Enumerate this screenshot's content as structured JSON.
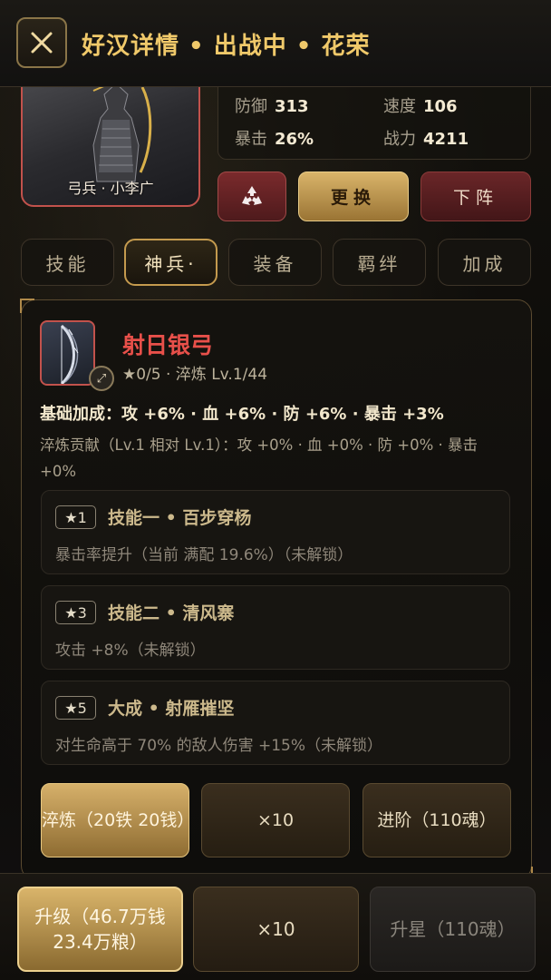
{
  "header": {
    "title": "好汉详情 • 出战中 • 花荣"
  },
  "hero": {
    "label": "弓兵 · 小李广"
  },
  "stats": [
    {
      "key": "防御",
      "value": "313"
    },
    {
      "key": "速度",
      "value": "106"
    },
    {
      "key": "暴击",
      "value": "26%"
    },
    {
      "key": "战力",
      "value": "4211"
    }
  ],
  "actions": {
    "recycle_icon": "recycle-icon",
    "swap": "更换",
    "dismiss": "下阵"
  },
  "tabs": [
    "技能",
    "神兵·",
    "装备",
    "羁绊",
    "加成"
  ],
  "active_tab": 1,
  "weapon": {
    "name": "射日银弓",
    "sub": "★0/5 · 淬炼 Lv.1/44",
    "base_bonus": "基础加成：攻 +6% · 血 +6% · 防 +6% · 暴击 +3%",
    "refine_contrib": "淬炼贡献（Lv.1 相对 Lv.1）：攻 +0% · 血 +0% · 防 +0% · 暴击 +0%"
  },
  "skills": [
    {
      "star": "★1",
      "title": "技能一 • 百步穿杨",
      "desc": "暴击率提升（当前 满配 19.6%）（未解锁）"
    },
    {
      "star": "★3",
      "title": "技能二 • 清风寨",
      "desc": "攻击 +8%（未解锁）"
    },
    {
      "star": "★5",
      "title": "大成 • 射雁摧坚",
      "desc": "对生命高于 70% 的敌人伤害 +15%（未解锁）"
    }
  ],
  "weapon_buttons": {
    "refine": "淬炼（20铁 20钱）",
    "x10": "×10",
    "advance": "进阶（110魂）"
  },
  "bottom_buttons": {
    "upgrade": "升级（46.7万钱 23.4万粮）",
    "x10": "×10",
    "star_up": "升星（110魂）"
  }
}
